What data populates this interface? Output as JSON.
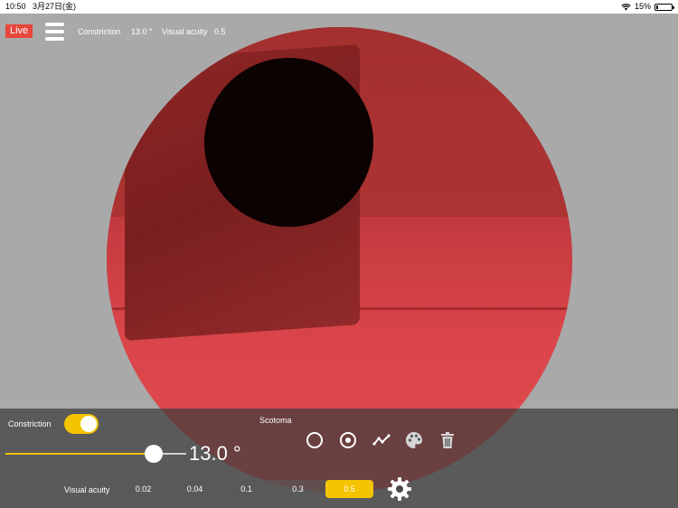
{
  "status_bar": {
    "time": "10:50",
    "date": "3月27日(金)",
    "battery": "15%",
    "battery_level": 0.15
  },
  "toolbar": {
    "live_label": "Live",
    "constriction_label": "Constriction",
    "constriction_value": "13.0 °",
    "visual_acuity_label": "Visual acuity",
    "visual_acuity_value": "0.5"
  },
  "panel": {
    "constriction_label": "Constriction",
    "constriction_enabled": true,
    "constriction_slider_fraction": 0.82,
    "constriction_value": "13.0 °",
    "scotoma_label": "Scotoma",
    "scotoma_tools": [
      "circle-outline-icon",
      "circle-dot-icon",
      "line-chart-icon",
      "palette-icon",
      "trash-icon"
    ],
    "visual_acuity_label": "Visual acuity",
    "acuity_options": [
      "0.02",
      "0.04",
      "0.1",
      "0.3",
      "0.5"
    ],
    "acuity_selected": "0.5"
  },
  "colors": {
    "accent": "#f5c400",
    "live_badge": "#e8473c",
    "scotoma": "#0d0202"
  }
}
